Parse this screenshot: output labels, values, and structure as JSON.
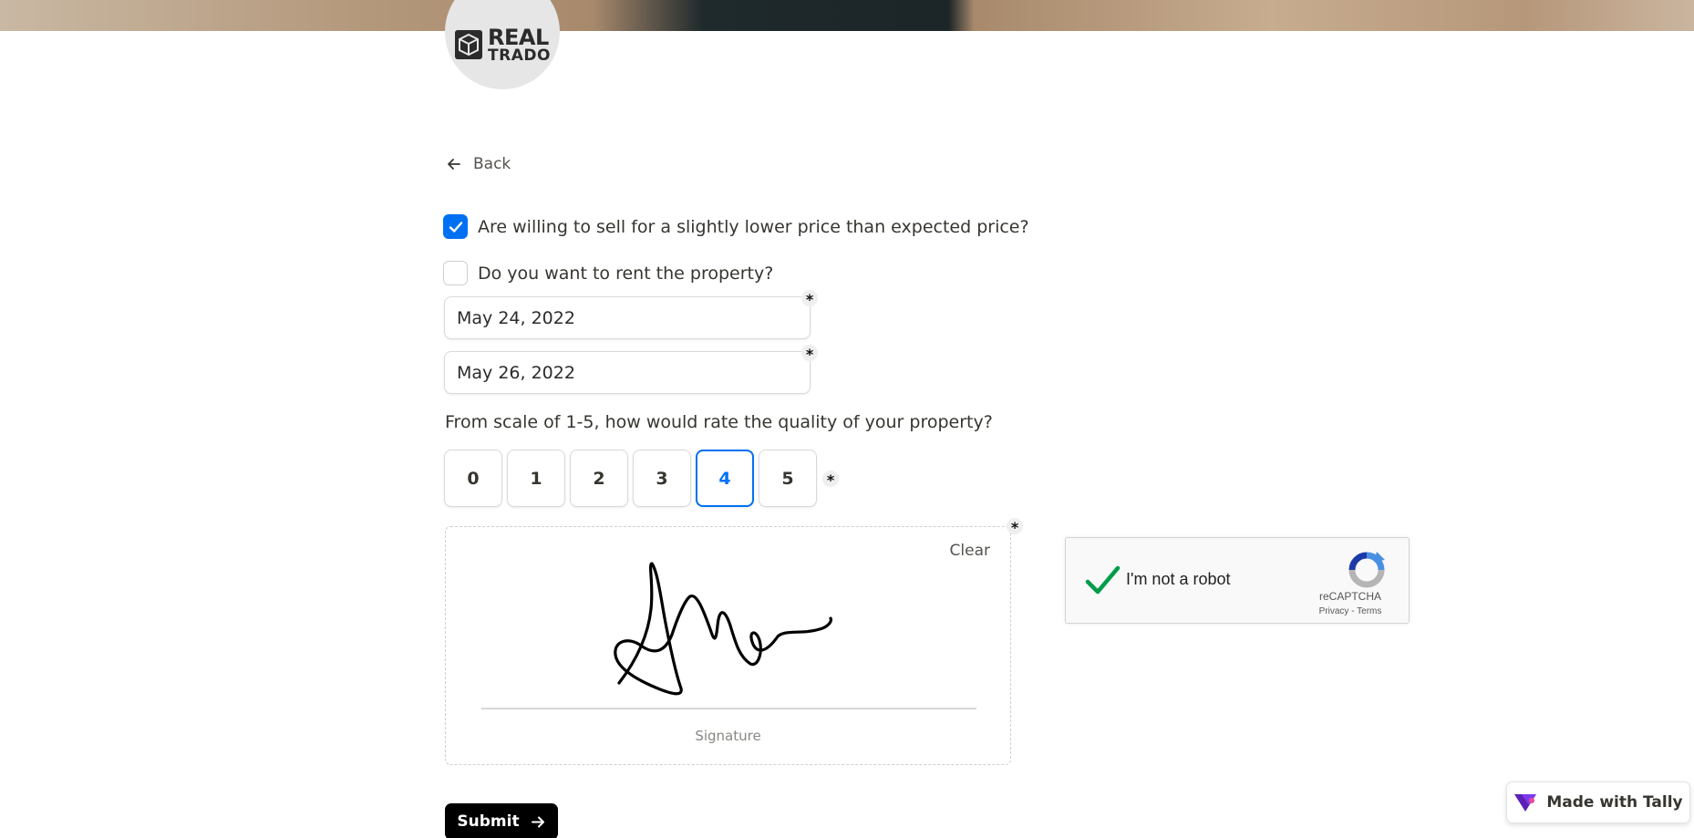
{
  "brand": {
    "logo_line1": "REAL",
    "logo_line2": "TRADO",
    "logo_icon": "cube-icon"
  },
  "nav": {
    "back_label": "Back",
    "back_icon": "arrow-left-icon"
  },
  "form": {
    "checkbox_sell": {
      "label": "Are willing to sell for a slightly lower price than expected price?",
      "checked": true
    },
    "checkbox_rent": {
      "label": "Do you want to rent the property?",
      "checked": false
    },
    "date_1": {
      "value": "May 24, 2022",
      "required_mark": "*"
    },
    "date_2": {
      "value": "May 26, 2022",
      "required_mark": "*"
    },
    "rating": {
      "question": "From scale of 1-5, how would rate the quality of your property?",
      "options": [
        "0",
        "1",
        "2",
        "3",
        "4",
        "5"
      ],
      "selected": "4",
      "required_mark": "*"
    },
    "signature": {
      "clear_label": "Clear",
      "caption": "Signature",
      "required_mark": "*"
    },
    "submit_label": "Submit"
  },
  "captcha": {
    "label": "I'm not a robot",
    "brand": "reCAPTCHA",
    "links": "Privacy - Terms",
    "checked": true
  },
  "footer": {
    "made_with": "Made with Tally"
  },
  "colors": {
    "accent": "#0070f3",
    "submit_bg": "#000000",
    "captcha_check": "#009c4a"
  }
}
